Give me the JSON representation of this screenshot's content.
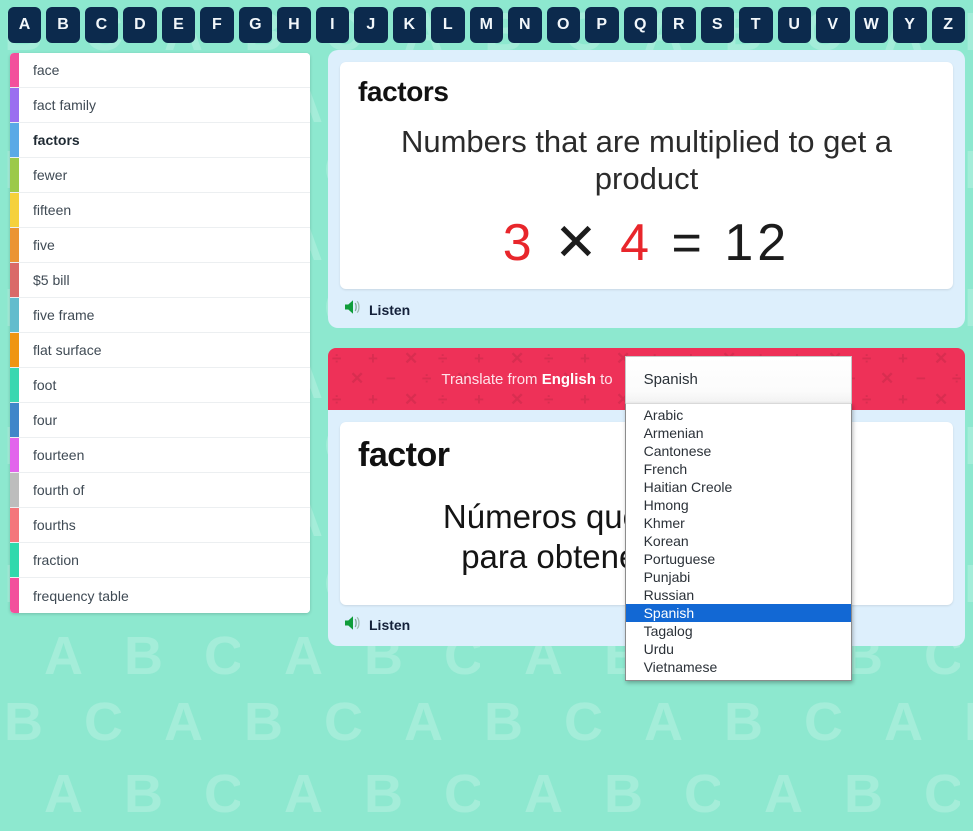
{
  "alphabet": {
    "letters": [
      "A",
      "B",
      "C",
      "D",
      "E",
      "F",
      "G",
      "H",
      "I",
      "J",
      "K",
      "L",
      "M",
      "N",
      "O",
      "P",
      "Q",
      "R",
      "S",
      "T",
      "U",
      "V",
      "W",
      "Y",
      "Z"
    ]
  },
  "word_list": {
    "items": [
      {
        "label": "face",
        "color": "#f3509c",
        "active": false
      },
      {
        "label": "fact family",
        "color": "#9a6ef0",
        "active": false
      },
      {
        "label": "factors",
        "color": "#5aa9e6",
        "active": true
      },
      {
        "label": "fewer",
        "color": "#9cc94a",
        "active": false
      },
      {
        "label": "fifteen",
        "color": "#f5d13c",
        "active": false
      },
      {
        "label": "five",
        "color": "#eb9434",
        "active": false
      },
      {
        "label": "$5 bill",
        "color": "#da6a68",
        "active": false
      },
      {
        "label": "five frame",
        "color": "#63bccd",
        "active": false
      },
      {
        "label": "flat surface",
        "color": "#ef9512",
        "active": false
      },
      {
        "label": "foot",
        "color": "#3ad7b0",
        "active": false
      },
      {
        "label": "four",
        "color": "#3f86c9",
        "active": false
      },
      {
        "label": "fourteen",
        "color": "#e264ec",
        "active": false
      },
      {
        "label": "fourth of",
        "color": "#bdbdbd",
        "active": false
      },
      {
        "label": "fourths",
        "color": "#f4767b",
        "active": false
      },
      {
        "label": "fraction",
        "color": "#2fd9ac",
        "active": false
      },
      {
        "label": "frequency table",
        "color": "#f3509c",
        "active": false
      }
    ]
  },
  "english_card": {
    "term": "factors",
    "definition": "Numbers that are multiplied to get a product",
    "equation": {
      "factor_a": "3",
      "operator": "✕",
      "factor_b": "4",
      "equals": "=",
      "product": "12",
      "factor_color": "#e8262b"
    },
    "listen_label": "Listen"
  },
  "translate": {
    "prefix": "Translate from",
    "source_language": "English",
    "suffix": "to",
    "selected_language": "Spanish",
    "bar_color": "#ee3158",
    "options": [
      "Arabic",
      "Armenian",
      "Cantonese",
      "French",
      "Haitian Creole",
      "Hmong",
      "Khmer",
      "Korean",
      "Portuguese",
      "Punjabi",
      "Russian",
      "Spanish",
      "Tagalog",
      "Urdu",
      "Vietnamese"
    ],
    "highlight_color": "#1268d4"
  },
  "translated_card": {
    "term": "factor",
    "definition_line_1": "Números que se multiplican",
    "definition_line_2": "para obtener un producto",
    "listen_label": "Listen"
  },
  "theme": {
    "background_color": "#8de8cf",
    "panel_color": "#ddeffc",
    "alphabet_button_color": "#0c2a4d",
    "background_letters": "A B C"
  }
}
